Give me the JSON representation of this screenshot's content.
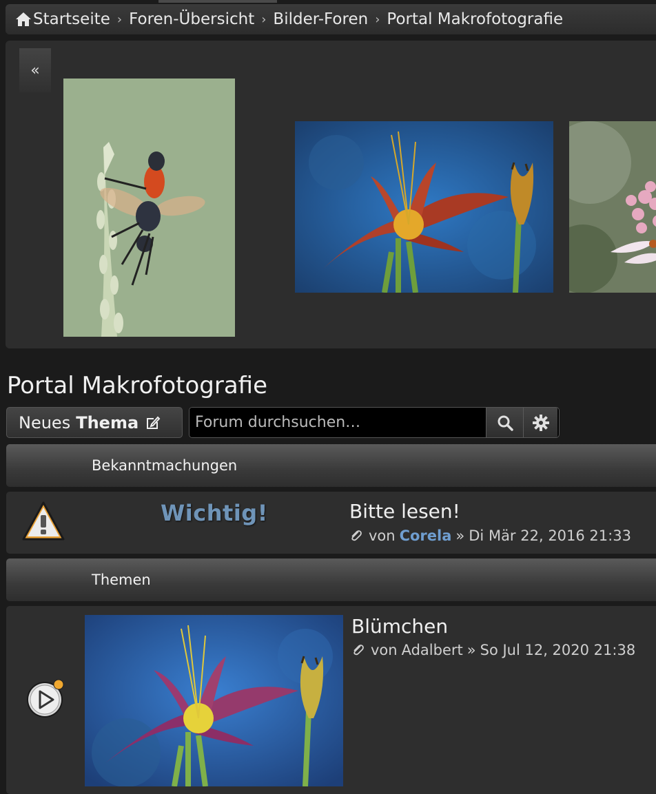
{
  "breadcrumb": {
    "items": [
      "Startseite",
      "Foren-Übersicht",
      "Bilder-Foren",
      "Portal Makrofotografie"
    ]
  },
  "gallery": {
    "prev_label": "«",
    "images": [
      "fly-on-grass",
      "orange-lily",
      "pink-astrantia-flower"
    ]
  },
  "forum": {
    "title": "Portal Makrofotografie"
  },
  "actions": {
    "new_topic_prefix": "Neues",
    "new_topic_bold": "Thema",
    "search_placeholder": "Forum durchsuchen…"
  },
  "sections": {
    "announcements": "Bekanntmachungen",
    "topics": "Themen"
  },
  "announcements": [
    {
      "badge": "Wichtig!",
      "title": "Bitte lesen!",
      "by": "von",
      "author": "Corela",
      "sep": "»",
      "date": "Di Mär 22, 2016 21:33"
    }
  ],
  "topics": [
    {
      "title": "Blümchen",
      "by": "von",
      "author": "Adalbert",
      "sep": "»",
      "date": "So Jul 12, 2020 21:38"
    }
  ],
  "colors": {
    "author_highlight": "#6f9ed0",
    "badge_text": "#6f94b8",
    "unread_dot": "#f0a830"
  }
}
